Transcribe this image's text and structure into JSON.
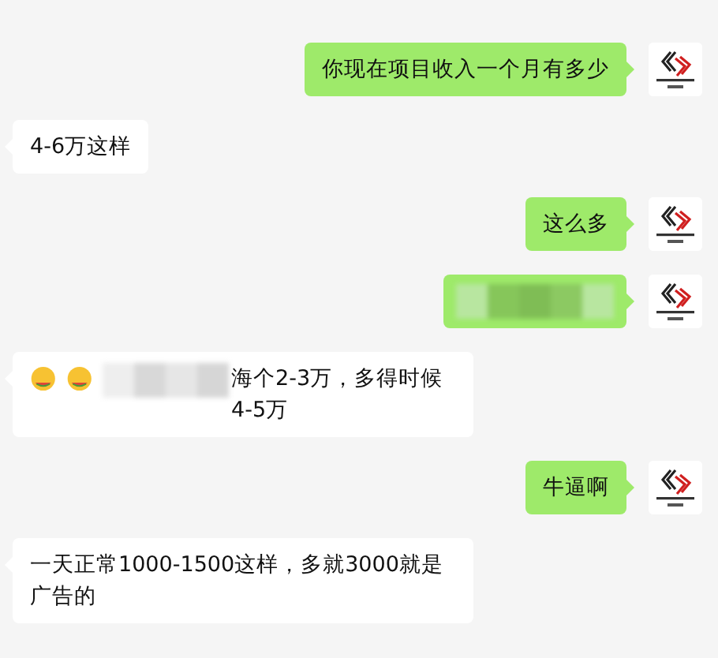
{
  "messages": [
    {
      "outgoing": true,
      "kind": "text",
      "text": "你现在项目收入一个月有多少"
    },
    {
      "outgoing": false,
      "kind": "text",
      "text": "4-6万这样"
    },
    {
      "outgoing": true,
      "kind": "text",
      "text": "这么多"
    },
    {
      "outgoing": true,
      "kind": "redacted"
    },
    {
      "outgoing": false,
      "kind": "mixed",
      "parts": [
        {
          "kind": "emoji"
        },
        {
          "kind": "emoji"
        },
        {
          "kind": "redacted"
        },
        {
          "kind": "text",
          "text": "海个2-3万，多得时候4-5万"
        }
      ]
    },
    {
      "outgoing": true,
      "kind": "text",
      "text": "牛逼啊"
    },
    {
      "outgoing": false,
      "kind": "text",
      "text": "一天正常1000-1500这样，多就3000就是广告的"
    }
  ]
}
